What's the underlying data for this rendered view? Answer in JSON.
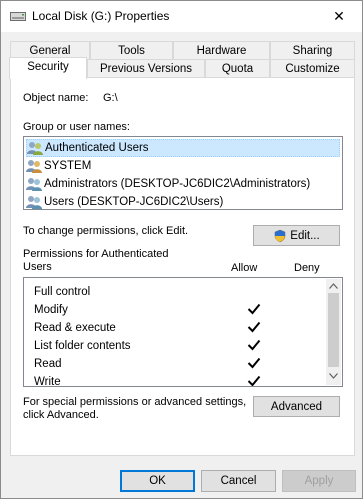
{
  "window": {
    "title": "Local Disk (G:) Properties",
    "close_glyph": "✕"
  },
  "tabs_row1": [
    "General",
    "Tools",
    "Hardware",
    "Sharing"
  ],
  "tabs_row2": [
    "Security",
    "Previous Versions",
    "Quota",
    "Customize"
  ],
  "active_tab": "Security",
  "object": {
    "label": "Object name:",
    "value": "G:\\"
  },
  "groups": {
    "label": "Group or user names:",
    "items": [
      {
        "name": "Authenticated Users",
        "selected": true
      },
      {
        "name": "SYSTEM",
        "selected": false
      },
      {
        "name": "Administrators (DESKTOP-JC6DIC2\\Administrators)",
        "selected": false
      },
      {
        "name": "Users (DESKTOP-JC6DIC2\\Users)",
        "selected": false
      }
    ]
  },
  "change_text": "To change permissions, click Edit.",
  "edit_label": "Edit...",
  "permissions": {
    "header_line1": "Permissions for Authenticated",
    "header_line2": "Users",
    "allow_label": "Allow",
    "deny_label": "Deny",
    "rows": [
      {
        "name": "Full control",
        "allow": false,
        "deny": false
      },
      {
        "name": "Modify",
        "allow": true,
        "deny": false
      },
      {
        "name": "Read & execute",
        "allow": true,
        "deny": false
      },
      {
        "name": "List folder contents",
        "allow": true,
        "deny": false
      },
      {
        "name": "Read",
        "allow": true,
        "deny": false
      },
      {
        "name": "Write",
        "allow": true,
        "deny": false
      }
    ]
  },
  "special": {
    "line1": "For special permissions or advanced settings,",
    "line2": "click Advanced.",
    "advanced_label": "Advanced"
  },
  "footer": {
    "ok_label": "OK",
    "cancel_label": "Cancel",
    "apply_label": "Apply"
  },
  "colors": {
    "selection": "#cce8ff",
    "default_button_border": "#0078d7"
  }
}
